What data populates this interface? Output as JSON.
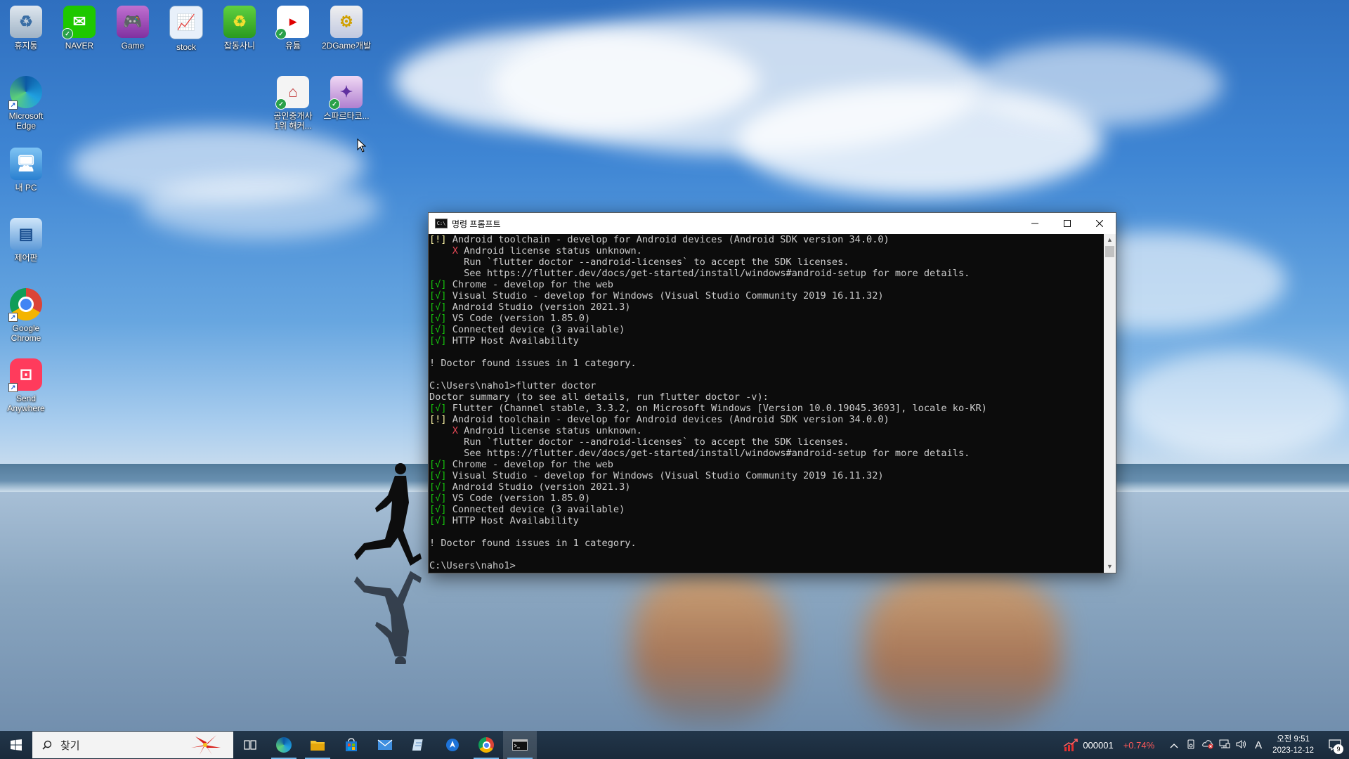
{
  "desktop": {
    "icons": [
      {
        "label": "휴지통"
      },
      {
        "label": "NAVER"
      },
      {
        "label": "Game"
      },
      {
        "label": "stock"
      },
      {
        "label": "잡동사니"
      },
      {
        "label": "유튬"
      },
      {
        "label": "2DGame개발"
      },
      {
        "label": "Microsoft\nEdge"
      },
      {
        "label": "공인중개사\n1위 해커..."
      },
      {
        "label": "스파르타코..."
      },
      {
        "label": "내 PC"
      },
      {
        "label": "제어판"
      },
      {
        "label": "Google\nChrome"
      },
      {
        "label": "Send\nAnywhere"
      }
    ]
  },
  "window": {
    "title": "명령 프롬프트",
    "icon_text": "C:\\",
    "lines": [
      {
        "tag": "[!]",
        "tag_class": "warn",
        "text": " Android toolchain - develop for Android devices (Android SDK version 34.0.0)"
      },
      {
        "pre": "    ",
        "tag": "X",
        "tag_class": "err",
        "text": " Android license status unknown."
      },
      {
        "text": "      Run `flutter doctor --android-licenses` to accept the SDK licenses."
      },
      {
        "text": "      See https://flutter.dev/docs/get-started/install/windows#android-setup for more details."
      },
      {
        "tag": "[√]",
        "tag_class": "ok",
        "text": " Chrome - develop for the web"
      },
      {
        "tag": "[√]",
        "tag_class": "ok",
        "text": " Visual Studio - develop for Windows (Visual Studio Community 2019 16.11.32)"
      },
      {
        "tag": "[√]",
        "tag_class": "ok",
        "text": " Android Studio (version 2021.3)"
      },
      {
        "tag": "[√]",
        "tag_class": "ok",
        "text": " VS Code (version 1.85.0)"
      },
      {
        "tag": "[√]",
        "tag_class": "ok",
        "text": " Connected device (3 available)"
      },
      {
        "tag": "[√]",
        "tag_class": "ok",
        "text": " HTTP Host Availability"
      },
      {
        "text": ""
      },
      {
        "text": "! Doctor found issues in 1 category."
      },
      {
        "text": ""
      },
      {
        "text": "C:\\Users\\naho1>flutter doctor"
      },
      {
        "text": "Doctor summary (to see all details, run flutter doctor -v):"
      },
      {
        "tag": "[√]",
        "tag_class": "ok",
        "text": " Flutter (Channel stable, 3.3.2, on Microsoft Windows [Version 10.0.19045.3693], locale ko-KR)"
      },
      {
        "tag": "[!]",
        "tag_class": "warn",
        "text": " Android toolchain - develop for Android devices (Android SDK version 34.0.0)"
      },
      {
        "pre": "    ",
        "tag": "X",
        "tag_class": "err",
        "text": " Android license status unknown."
      },
      {
        "text": "      Run `flutter doctor --android-licenses` to accept the SDK licenses."
      },
      {
        "text": "      See https://flutter.dev/docs/get-started/install/windows#android-setup for more details."
      },
      {
        "tag": "[√]",
        "tag_class": "ok",
        "text": " Chrome - develop for the web"
      },
      {
        "tag": "[√]",
        "tag_class": "ok",
        "text": " Visual Studio - develop for Windows (Visual Studio Community 2019 16.11.32)"
      },
      {
        "tag": "[√]",
        "tag_class": "ok",
        "text": " Android Studio (version 2021.3)"
      },
      {
        "tag": "[√]",
        "tag_class": "ok",
        "text": " VS Code (version 1.85.0)"
      },
      {
        "tag": "[√]",
        "tag_class": "ok",
        "text": " Connected device (3 available)"
      },
      {
        "tag": "[√]",
        "tag_class": "ok",
        "text": " HTTP Host Availability"
      },
      {
        "text": ""
      },
      {
        "text": "! Doctor found issues in 1 category."
      },
      {
        "text": ""
      },
      {
        "text": "C:\\Users\\naho1>"
      }
    ]
  },
  "taskbar": {
    "search_placeholder": "찾기",
    "stock_code": "000001",
    "stock_change": "+0.74%",
    "clock_time": "오전 9:51",
    "clock_date": "2023-12-12",
    "ime": "A",
    "notification_count": "9"
  },
  "colors": {
    "console_bg": "#0c0c0c",
    "console_text": "#cccccc",
    "ok": "#16c60c",
    "warn": "#f9f1a5",
    "err": "#e74856"
  }
}
